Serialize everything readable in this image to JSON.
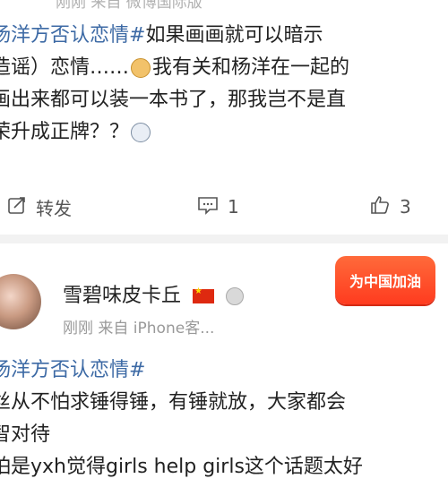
{
  "post1": {
    "meta_partial": "刚刚 来自 微博国际版",
    "topic": "杨洋方否认恋情#",
    "line1_rest": " 如果画画就可以暗示",
    "line2": "造谣）恋情……",
    "line2_rest": "我有关和杨洋在一起的",
    "line3": "画出来都可以装一本书了，那我岂不是直",
    "line4": "荣升成正牌？？",
    "actions": {
      "repost_label": "转发",
      "comment_count": "1",
      "like_count": "3"
    }
  },
  "post2": {
    "username": "雪碧味皮卡丘",
    "meta": "刚刚  来自 iPhone客...",
    "badge_text": "为中国加油",
    "topic": "杨洋方否认恋情#",
    "line2": "丝从不怕求锤得锤，有锤就放，大家都会",
    "line3": "智对待",
    "line4": "怕是yxh觉得girls help girls这个话题太好"
  },
  "colors": {
    "topic_link": "#3d6aa5",
    "meta_gray": "#999999",
    "divider": "#f2f2f2",
    "badge": "#ff3b1f"
  },
  "icons": {
    "repost": "repost-icon",
    "comment": "comment-icon",
    "like": "like-thumb-icon",
    "emoji1": "doge-emoji-icon",
    "emoji2": "husky-emoji-icon",
    "flag": "china-flag-icon",
    "medal": "medal-icon"
  }
}
